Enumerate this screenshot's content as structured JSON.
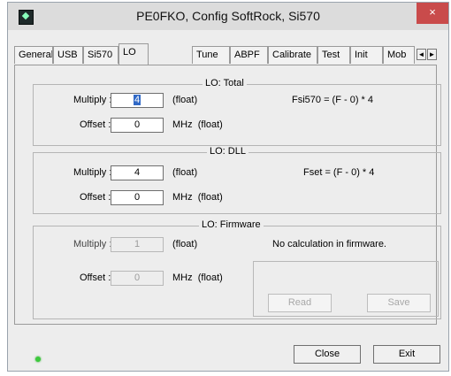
{
  "window": {
    "title": "PE0FKO, Config SoftRock, Si570",
    "close_glyph": "×"
  },
  "tabs": [
    {
      "label": "General"
    },
    {
      "label": "USB"
    },
    {
      "label": "Si570"
    },
    {
      "label": "LO",
      "active": true
    },
    {
      "label": "Tune"
    },
    {
      "label": "ABPF"
    },
    {
      "label": "Calibrate"
    },
    {
      "label": "Test"
    },
    {
      "label": "Init"
    },
    {
      "label": "Mob"
    }
  ],
  "tab_scroll": {
    "left": "◄",
    "right": "►"
  },
  "lo_total": {
    "title": "LO: Total",
    "multiply_label": "Multiply :",
    "multiply_value": "4",
    "multiply_unit": "(float)",
    "offset_label": "Offset :",
    "offset_value": "0",
    "offset_unit": "MHz  (float)",
    "formula": "Fsi570 = (F - 0) * 4"
  },
  "lo_dll": {
    "title": "LO: DLL",
    "multiply_label": "Multiply :",
    "multiply_value": "4",
    "multiply_unit": "(float)",
    "offset_label": "Offset :",
    "offset_value": "0",
    "offset_unit": "MHz  (float)",
    "formula": "Fset = (F - 0) * 4"
  },
  "lo_firmware": {
    "title": "LO: Firmware",
    "multiply_label": "Multiply :",
    "multiply_value": "1",
    "multiply_unit": "(float)",
    "offset_label": "Offset :",
    "offset_value": "0",
    "offset_unit": "MHz  (float)",
    "note": "No calculation in firmware.",
    "read_label": "Read",
    "save_label": "Save"
  },
  "footer": {
    "close_label": "Close",
    "exit_label": "Exit"
  }
}
